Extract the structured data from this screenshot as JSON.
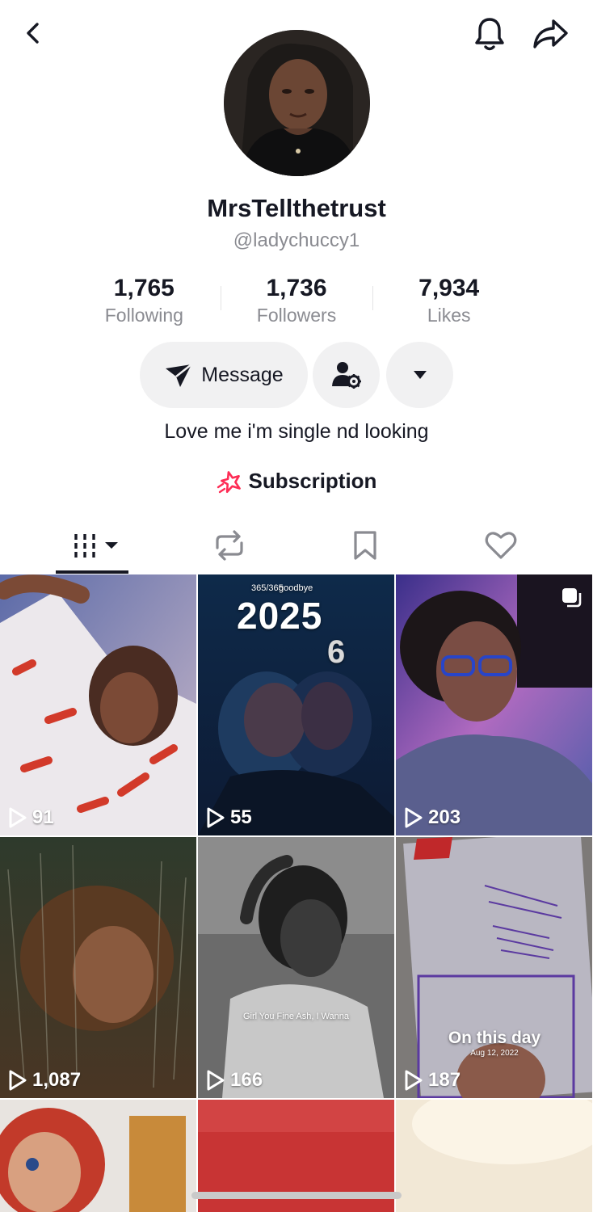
{
  "profile": {
    "display_name": "MrsTellthetrust",
    "handle": "@ladychuccy1",
    "bio": "Love me i'm single nd looking",
    "subscription_label": "Subscription"
  },
  "stats": [
    {
      "value": "1,765",
      "label": "Following"
    },
    {
      "value": "1,736",
      "label": "Followers"
    },
    {
      "value": "7,934",
      "label": "Likes"
    }
  ],
  "actions": {
    "message_label": "Message"
  },
  "icons": {
    "back": "chevron-left-icon",
    "bell": "bell-icon",
    "share": "share-icon",
    "message": "paper-plane-icon",
    "add_friend": "person-gear-icon",
    "more": "caret-down-icon",
    "subscription": "star-icon",
    "tab_videos": "grid-bars-icon",
    "tab_repost": "repost-icon",
    "tab_saved": "bookmark-icon",
    "tab_liked": "heart-icon",
    "play": "play-icon",
    "multi": "multi-photo-icon"
  },
  "colors": {
    "accent": "#fe2c55",
    "text_primary": "#161823",
    "text_secondary": "#8a8b91",
    "button_bg": "#f1f1f2"
  },
  "videos": [
    {
      "views": "91"
    },
    {
      "views": "55",
      "overlay_top": "365/365",
      "overlay_top2": "goodbye",
      "overlay_year": "2025",
      "overlay_digit": "6"
    },
    {
      "views": "203"
    },
    {
      "views": "1,087"
    },
    {
      "views": "166",
      "caption": "Girl You Fine Ash, I Wanna"
    },
    {
      "views": "187",
      "caption": "On this day",
      "date": "Aug 12, 2022"
    },
    {
      "views": ""
    },
    {
      "views": ""
    },
    {
      "views": ""
    }
  ]
}
